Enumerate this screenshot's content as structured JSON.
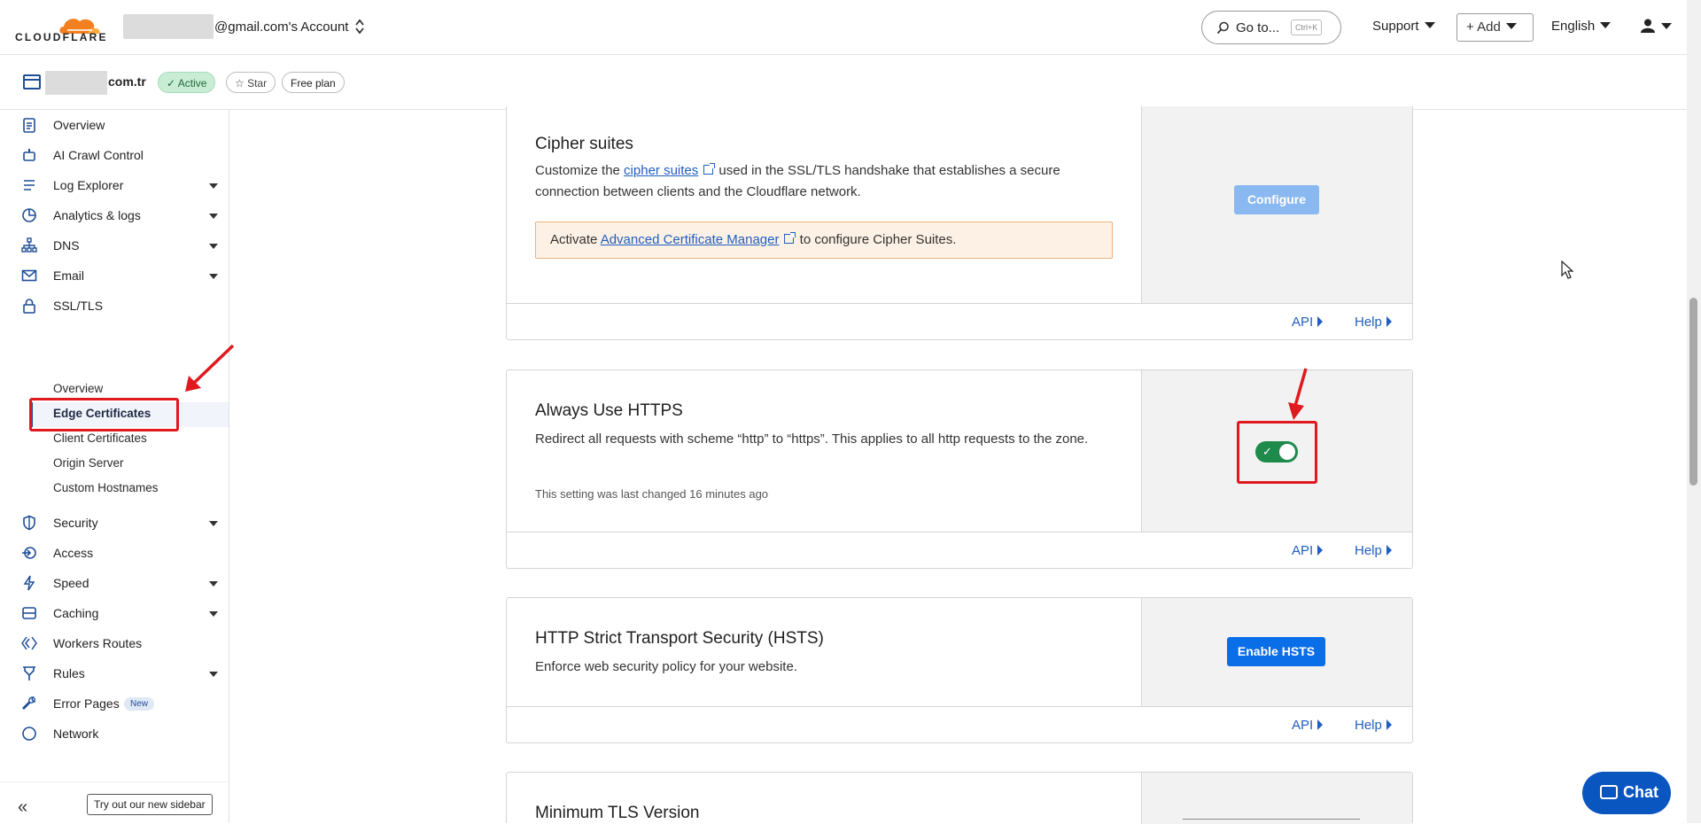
{
  "header": {
    "logo_text": "CLOUDFLARE",
    "account_label": "@gmail.com's Account",
    "goto_label": "Go to...",
    "goto_shortcut": "Ctrl+K",
    "support_label": "Support",
    "add_label": "+ Add",
    "language_label": "English"
  },
  "zone": {
    "name": "com.tr",
    "status": "Active",
    "star_label": "Star",
    "plan_label": "Free plan"
  },
  "sidebar": {
    "items": [
      {
        "label": "Overview",
        "icon": "clipboard-icon"
      },
      {
        "label": "AI Crawl Control",
        "icon": "robot-icon"
      },
      {
        "label": "Log Explorer",
        "icon": "log-icon"
      },
      {
        "label": "Analytics & logs",
        "icon": "chart-icon"
      },
      {
        "label": "DNS",
        "icon": "network-icon"
      },
      {
        "label": "Email",
        "icon": "mail-icon"
      },
      {
        "label": "SSL/TLS",
        "icon": "lock-icon"
      },
      {
        "label": "Security",
        "icon": "shield-icon"
      },
      {
        "label": "Access",
        "icon": "access-icon"
      },
      {
        "label": "Speed",
        "icon": "bolt-icon"
      },
      {
        "label": "Caching",
        "icon": "database-icon"
      },
      {
        "label": "Workers Routes",
        "icon": "workers-icon"
      },
      {
        "label": "Rules",
        "icon": "rules-icon"
      },
      {
        "label": "Error Pages",
        "icon": "wrench-icon",
        "badge": "New"
      },
      {
        "label": "Network",
        "icon": "globe-icon"
      }
    ],
    "ssl_sub": [
      "Overview",
      "Edge Certificates",
      "Client Certificates",
      "Origin Server",
      "Custom Hostnames"
    ],
    "try_label": "Try out our new sidebar"
  },
  "cards": {
    "cipher": {
      "title": "Cipher suites",
      "desc_pre": "Customize the ",
      "desc_link": "cipher suites",
      "desc_post": " used in the SSL/TLS handshake that establishes a secure connection between clients and the Cloudflare network.",
      "warn_pre": "Activate ",
      "warn_link": "Advanced Certificate Manager",
      "warn_post": " to configure Cipher Suites.",
      "button": "Configure"
    },
    "https": {
      "title": "Always Use HTTPS",
      "desc": "Redirect all requests with scheme “http” to “https”. This applies to all http requests to the zone.",
      "note": "This setting was last changed 16 minutes ago",
      "toggle_on": true
    },
    "hsts": {
      "title": "HTTP Strict Transport Security (HSTS)",
      "desc": "Enforce web security policy for your website.",
      "button": "Enable HSTS"
    },
    "tls": {
      "title": "Minimum TLS Version"
    },
    "api_label": "API",
    "help_label": "Help"
  },
  "chat_label": "Chat",
  "colors": {
    "accent": "#0a6ee8",
    "highlight": "#e0191f",
    "toggle_on": "#1e8a4b",
    "brand_orange": "#f38020"
  }
}
